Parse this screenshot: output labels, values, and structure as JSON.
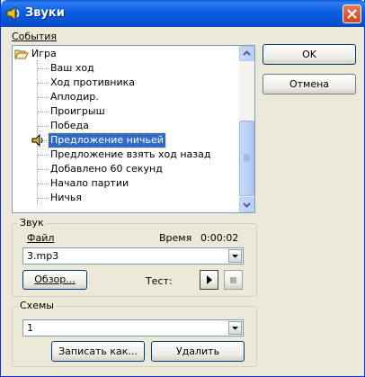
{
  "window": {
    "title": "Звуки",
    "title_icon": "speaker-note-icon",
    "close_icon": "close-icon"
  },
  "events": {
    "label": "События",
    "root_label": "Игра",
    "items": [
      "Ваш ход",
      "Ход противника",
      "Аплодир.",
      "Проигрыш",
      "Победа",
      "Предложение ничьей",
      "Предложение взять ход назад",
      "Добавлено 60 секунд",
      "Начало партии",
      "Ничья"
    ],
    "selected_index": 5
  },
  "buttons": {
    "ok": "OK",
    "cancel": "Отмена"
  },
  "sound": {
    "group_label": "Звук",
    "file_label": "Файл",
    "time_label": "Время",
    "time_value": "0:00:02",
    "file_value": "3.mp3",
    "browse_label": "Обзор...",
    "test_label": "Тест:"
  },
  "schemes": {
    "group_label": "Схемы",
    "selected": "1",
    "save_as_label": "Записать как...",
    "delete_label": "Удалить"
  }
}
